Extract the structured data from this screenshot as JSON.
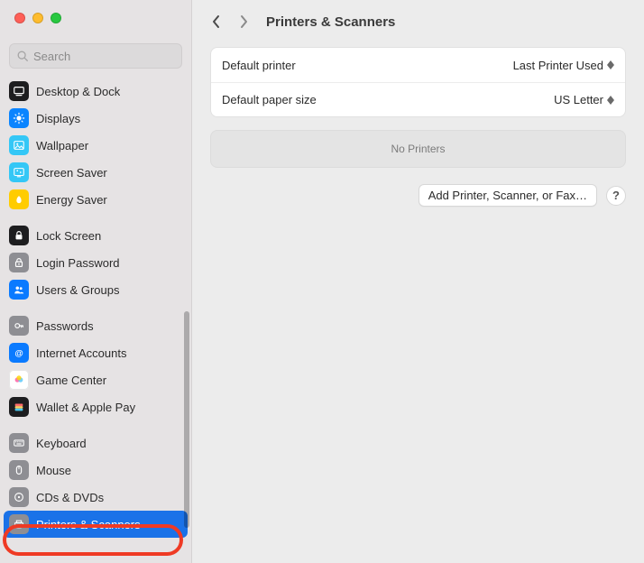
{
  "window": {
    "title": "Printers & Scanners"
  },
  "search": {
    "placeholder": "Search",
    "value": ""
  },
  "sidebar": {
    "groups": [
      [
        {
          "label": "Desktop & Dock",
          "icon": "desktop-dock",
          "bg": "#1d1d1f"
        },
        {
          "label": "Displays",
          "icon": "displays",
          "bg": "#0a84ff"
        },
        {
          "label": "Wallpaper",
          "icon": "wallpaper",
          "bg": "#34c7f6"
        },
        {
          "label": "Screen Saver",
          "icon": "screen-saver",
          "bg": "#34c7f6"
        },
        {
          "label": "Energy Saver",
          "icon": "energy-saver",
          "bg": "#ffcc00"
        }
      ],
      [
        {
          "label": "Lock Screen",
          "icon": "lock-screen",
          "bg": "#1d1d1f"
        },
        {
          "label": "Login Password",
          "icon": "login-pass",
          "bg": "#8e8e93"
        },
        {
          "label": "Users & Groups",
          "icon": "users-groups",
          "bg": "#0a7aff"
        }
      ],
      [
        {
          "label": "Passwords",
          "icon": "passwords",
          "bg": "#8e8e93"
        },
        {
          "label": "Internet Accounts",
          "icon": "internet",
          "bg": "#0a7aff"
        },
        {
          "label": "Game Center",
          "icon": "game-center",
          "bg": "#ffffff"
        },
        {
          "label": "Wallet & Apple Pay",
          "icon": "wallet",
          "bg": "#1d1d1f"
        }
      ],
      [
        {
          "label": "Keyboard",
          "icon": "keyboard",
          "bg": "#8e8e93"
        },
        {
          "label": "Mouse",
          "icon": "mouse",
          "bg": "#8e8e93"
        },
        {
          "label": "CDs & DVDs",
          "icon": "disc",
          "bg": "#8e8e93"
        },
        {
          "label": "Printers & Scanners",
          "icon": "printer",
          "bg": "#8e8e93",
          "selected": true
        }
      ]
    ]
  },
  "settings": {
    "rows": [
      {
        "label": "Default printer",
        "value": "Last Printer Used"
      },
      {
        "label": "Default paper size",
        "value": "US Letter"
      }
    ]
  },
  "empty_state": "No Printers",
  "add_button": "Add Printer, Scanner, or Fax…",
  "help_label": "?",
  "colors": {
    "selection": "#1a72e8",
    "annotation": "#ef3a24"
  }
}
